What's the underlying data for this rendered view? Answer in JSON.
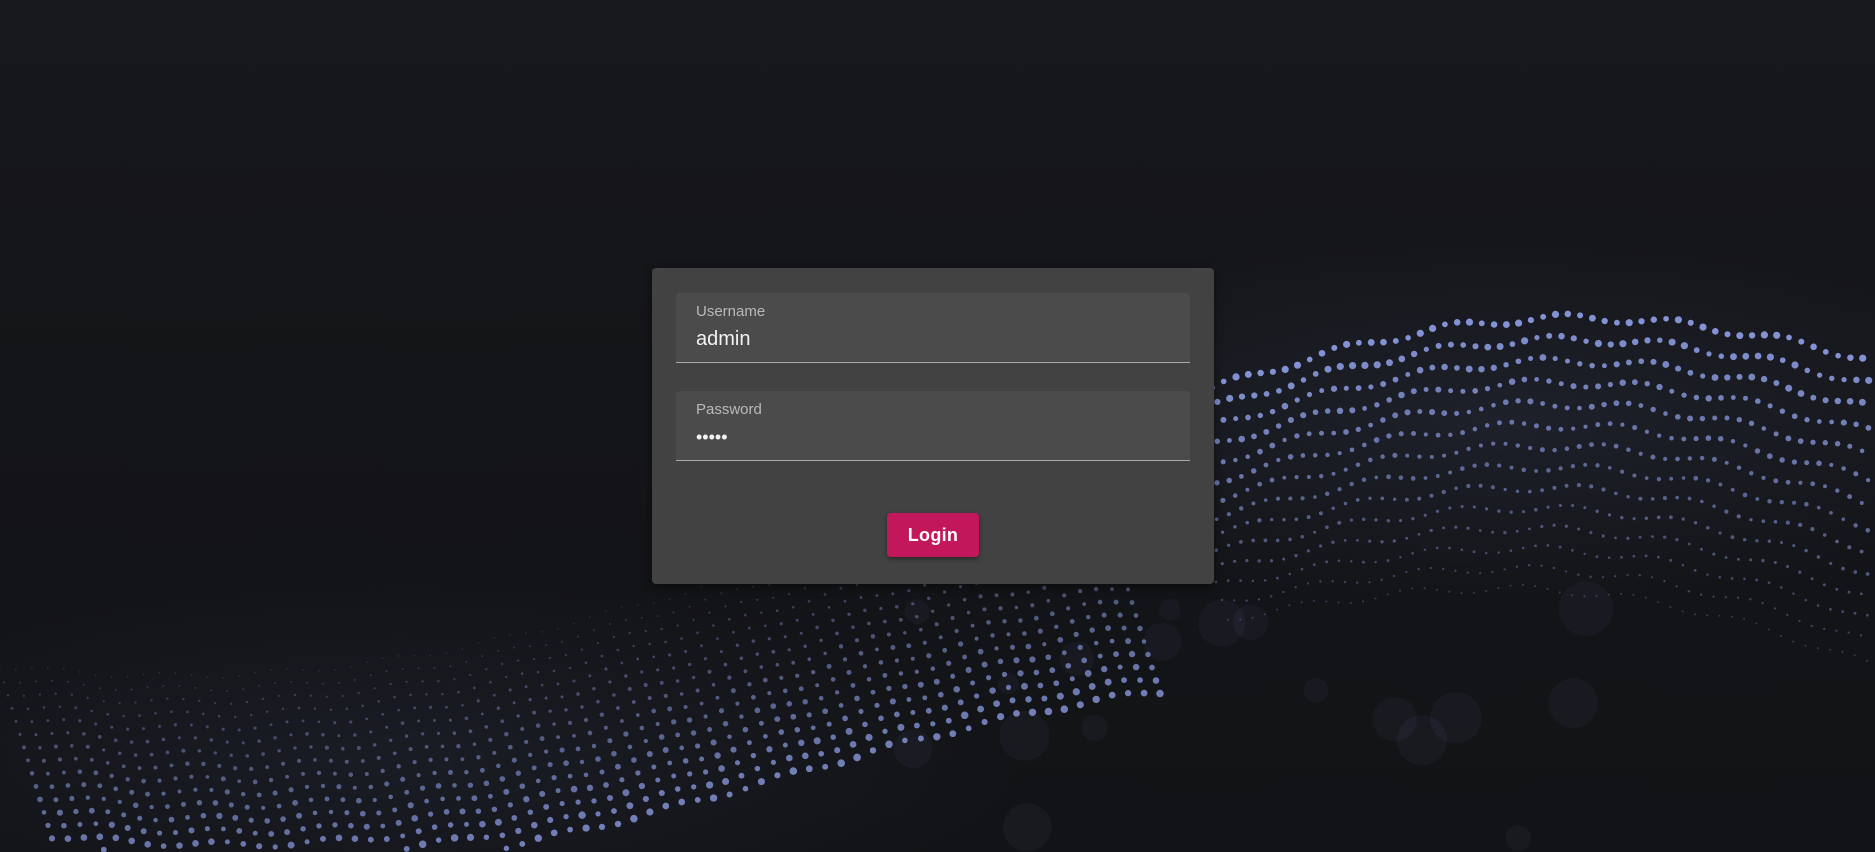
{
  "login_form": {
    "username": {
      "label": "Username",
      "value": "admin"
    },
    "password": {
      "label": "Password",
      "value": "•••••"
    },
    "submit_label": "Login"
  },
  "colors": {
    "card_background": "#424242",
    "field_background": "#4b4b4b",
    "button_accent": "#c2185b",
    "page_background": "#141518",
    "particle_color": "#8fa0e8"
  },
  "background": {
    "image": "particle-wave-icon"
  }
}
